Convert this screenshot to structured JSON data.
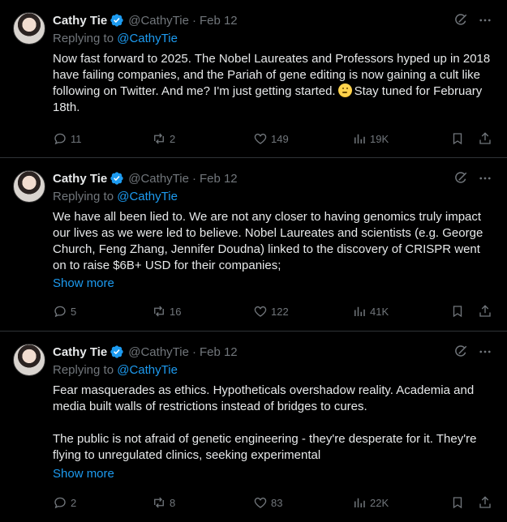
{
  "tweets": [
    {
      "name": "Cathy Tie",
      "handle": "@CathyTie",
      "separator": "·",
      "date": "Feb 12",
      "replying_prefix": "Replying to ",
      "replying_to": "@CathyTie",
      "text_parts": [
        "Now fast forward to 2025. The Nobel Laureates and Professors hyped up in 2018 have failing companies, and the Pariah of gene editing is now gaining a cult like following on Twitter. And me? I'm just getting started.",
        "Stay tuned for February 18th."
      ],
      "emoji": "shushing-face-emoji",
      "show_more": "",
      "replies": "11",
      "reposts": "2",
      "likes": "149",
      "views": "19K"
    },
    {
      "name": "Cathy Tie",
      "handle": "@CathyTie",
      "separator": "·",
      "date": "Feb 12",
      "replying_prefix": "Replying to ",
      "replying_to": "@CathyTie",
      "text": "We have all been lied to. We are not any closer to having genomics truly impact our lives as we were led to believe. Nobel Laureates and scientists (e.g. George Church, Feng Zhang, Jennifer Doudna) linked to the discovery of CRISPR went on to raise $6B+ USD for their companies;",
      "show_more": "Show more",
      "replies": "5",
      "reposts": "16",
      "likes": "122",
      "views": "41K"
    },
    {
      "name": "Cathy Tie",
      "handle": "@CathyTie",
      "separator": "·",
      "date": "Feb 12",
      "replying_prefix": "Replying to ",
      "replying_to": "@CathyTie",
      "text_p1": "Fear masquerades as ethics. Hypotheticals overshadow reality. Academia and media built walls of restrictions instead of bridges to cures.",
      "text_p2": "The public is not afraid of genetic engineering - they're desperate for it. They're flying to unregulated clinics, seeking experimental",
      "show_more": "Show more",
      "replies": "2",
      "reposts": "8",
      "likes": "83",
      "views": "22K"
    }
  ],
  "colors": {
    "background": "#000000",
    "text": "#e7e9ea",
    "muted": "#71767b",
    "accent": "#1d9bf0",
    "divider": "#2f3336"
  }
}
